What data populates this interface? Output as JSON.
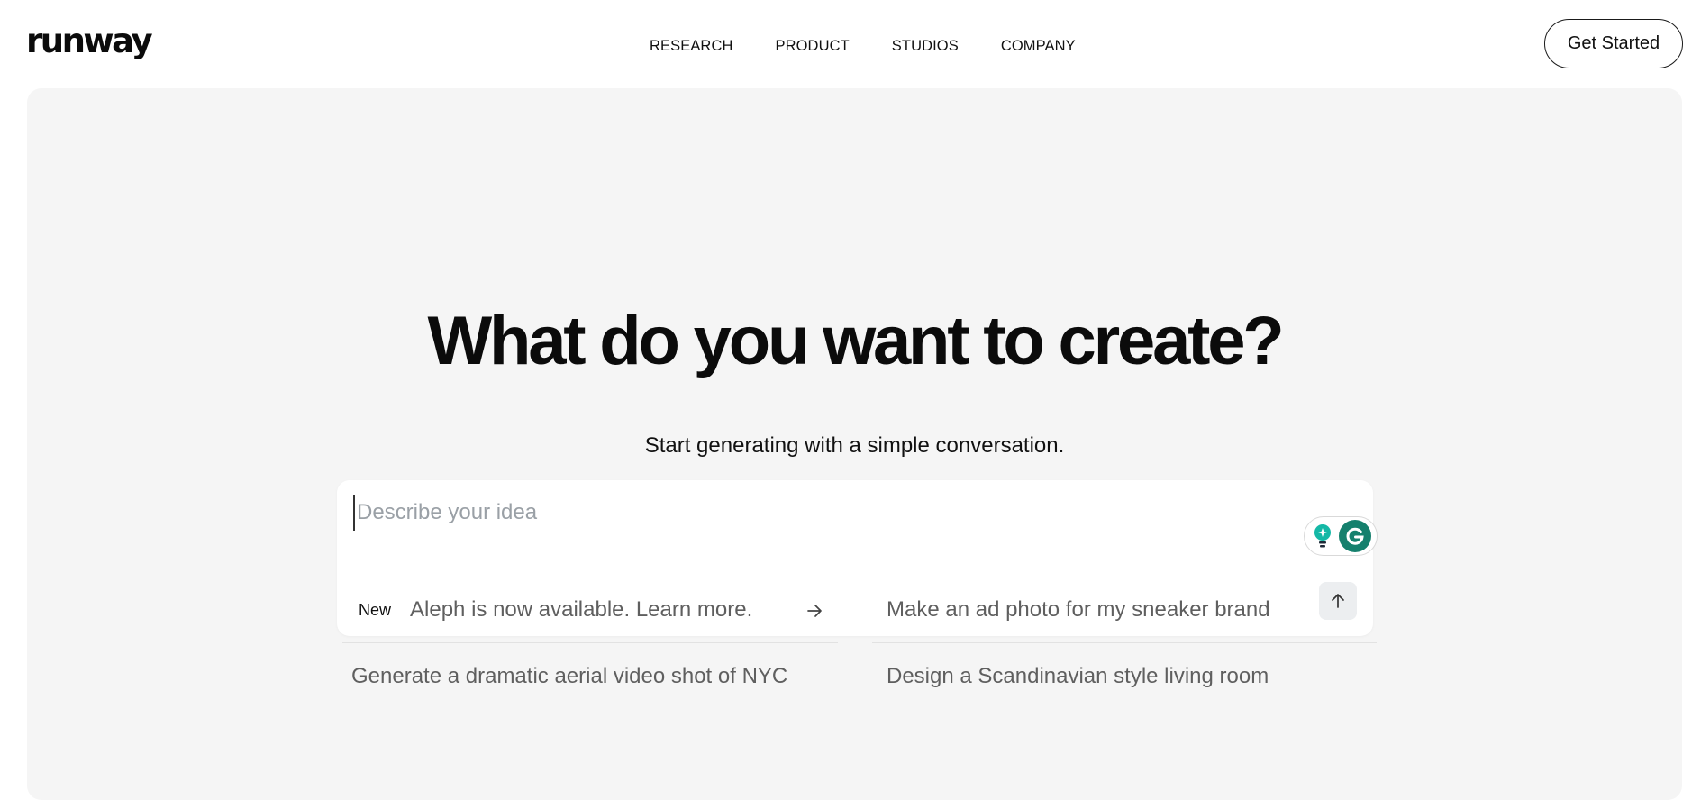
{
  "header": {
    "logo": "runway",
    "nav": [
      "RESEARCH",
      "PRODUCT",
      "STUDIOS",
      "COMPANY"
    ],
    "cta_label": "Get Started"
  },
  "hero": {
    "title": "What do you want to create?",
    "subtitle": "Start generating with a simple conversation."
  },
  "prompt": {
    "placeholder": "Describe your idea",
    "value": ""
  },
  "suggestions": {
    "new_badge": "New",
    "items": [
      "Aleph is now available. Learn more.",
      "Make an ad photo for my sneaker brand",
      "Generate a dramatic aerial video shot of NYC",
      "Design a Scandinavian style living room"
    ]
  },
  "colors": {
    "hero_bg": "#f5f5f5",
    "grammarly": "#15806d",
    "accent_teal": "#14b8a6"
  }
}
